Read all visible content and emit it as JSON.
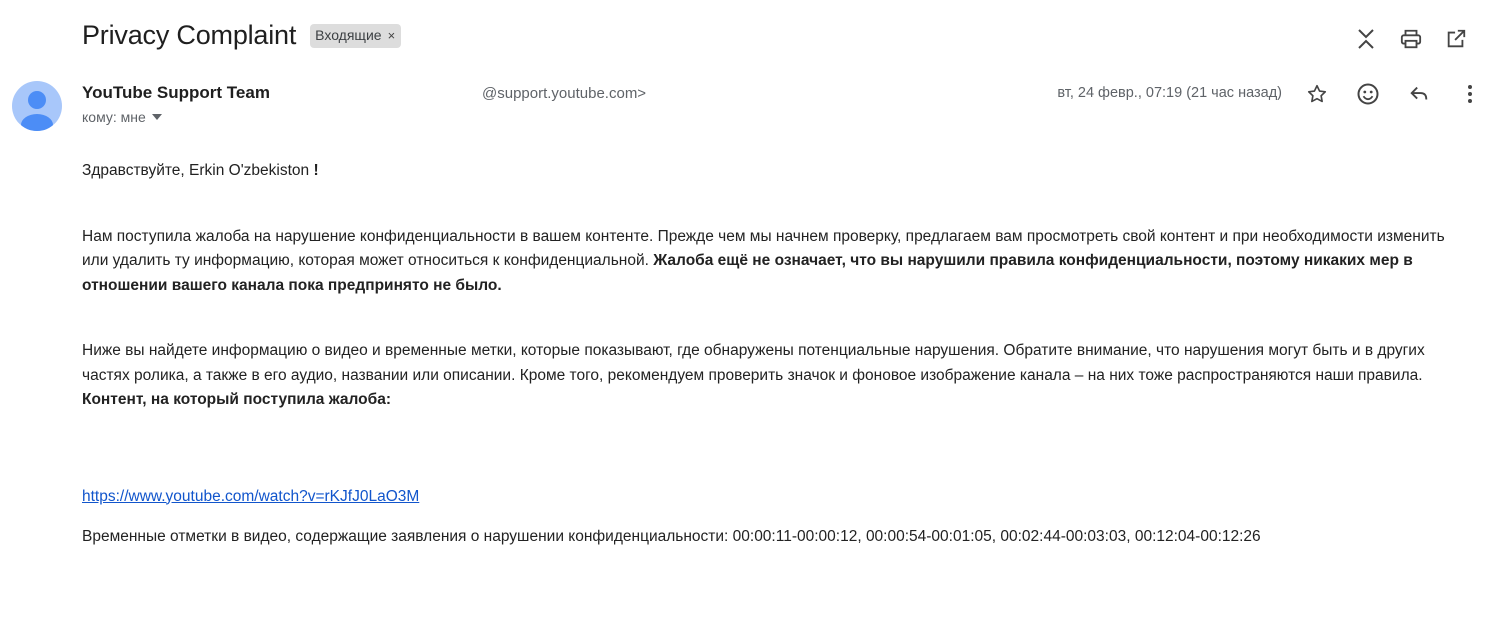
{
  "email": {
    "subject": "Privacy Complaint",
    "label": "Входящие",
    "label_remove": "×",
    "sender": {
      "name": "YouTube Support Team",
      "email": "@support.youtube.com>",
      "recipient_prefix": "кому: мне"
    },
    "date": "вт, 24 февр., 07:19 (21 час назад)"
  },
  "icons": {
    "top": [
      "expand-collapse-icon",
      "print-icon",
      "open-new-window-icon"
    ],
    "actions": [
      "star-icon",
      "emoji-icon",
      "reply-icon",
      "more-vert-icon"
    ]
  },
  "body": {
    "greeting_name": "Здравствуйте, Erkin O'zbekiston",
    "greeting_end": "!",
    "p1_normal": "Нам поступила жалоба на нарушение конфиденциальности в вашем контенте. Прежде чем мы начнем проверку, предлагаем вам просмотреть свой контент и при необходимости изменить или удалить ту информацию, которая может относиться к конфиденциальной.",
    "p1_bold": "Жалоба ещё не означает, что вы нарушили правила конфиденциальности, поэтому никаких мер в отношении вашего канала пока предпринято не было.",
    "p2": "Ниже вы найдете информацию о видео и временные метки, которые показывают, где обнаружены потенциальные нарушения. Обратите внимание, что нарушения могут быть и в других частях ролика, а также в его аудио, названии или описании. Кроме того, рекомендуем проверить значок и фоновое изображение канала – на них тоже распространяются наши правила.",
    "content_heading": "Контент, на который поступила жалоба:",
    "video_link": "https://www.youtube.com/watch?v=rKJfJ0LaO3M",
    "timestamps": "Временные отметки в видео, содержащие заявления о нарушении конфиденциальности: 00:00:11-00:00:12, 00:00:54-00:01:05, 00:02:44-00:03:03, 00:12:04-00:12:26"
  }
}
